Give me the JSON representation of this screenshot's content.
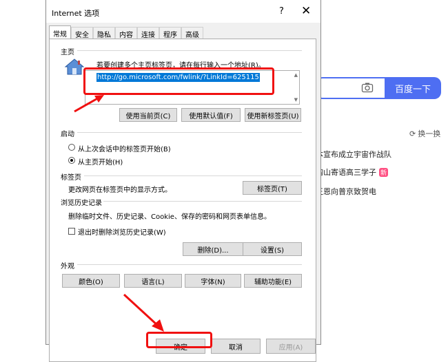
{
  "background": {
    "search_button": "百度一下",
    "refresh": "换一换",
    "news": [
      {
        "text": "本宣布成立宇宙作战队"
      },
      {
        "text": "掏山寄语高三学子",
        "badge": "新"
      },
      {
        "text": "王恩向普京致贺电"
      }
    ]
  },
  "dialog": {
    "title": "Internet 选项",
    "help": "?",
    "close": "✕",
    "tabs": [
      "常规",
      "安全",
      "隐私",
      "内容",
      "连接",
      "程序",
      "高级"
    ],
    "home": {
      "label": "主页",
      "desc": "若要创建多个主页标签页，请在每行输入一个地址(R)。",
      "url": "http://go.microsoft.com/fwlink/?LinkId=625115",
      "btn_current": "使用当前页(C)",
      "btn_default": "使用默认值(F)",
      "btn_newtab": "使用新标签页(U)"
    },
    "startup": {
      "label": "启动",
      "option_last": "从上次会话中的标签页开始(B)",
      "option_home": "从主页开始(H)"
    },
    "tabsgroup": {
      "label": "标签页",
      "desc": "更改网页在标签页中的显示方式。",
      "btn": "标签页(T)"
    },
    "history": {
      "label": "浏览历史记录",
      "desc": "删除临时文件、历史记录、Cookie、保存的密码和网页表单信息。",
      "check": "退出时删除浏览历史记录(W)",
      "btn_delete": "删除(D)...",
      "btn_settings": "设置(S)"
    },
    "appearance": {
      "label": "外观",
      "btn_colors": "颜色(O)",
      "btn_languages": "语言(L)",
      "btn_fonts": "字体(N)",
      "btn_access": "辅助功能(E)"
    },
    "footer": {
      "ok": "确定",
      "cancel": "取消",
      "apply": "应用(A)"
    }
  },
  "colors": {
    "accent": "#4e6ef2",
    "highlight": "#f01010"
  }
}
